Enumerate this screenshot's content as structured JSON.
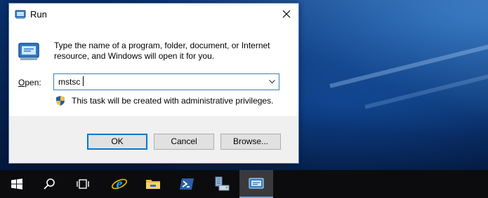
{
  "window": {
    "title": "Run",
    "icon": "run-app-icon",
    "close_icon": "close-icon"
  },
  "body": {
    "description": "Type the name of a program, folder, document, or Internet resource, and Windows will open it for you.",
    "open_label_prefix": "",
    "open_label_accel": "O",
    "open_label_suffix": "pen:",
    "open_value": "mstsc",
    "admin_note": "This task will be created with administrative privileges."
  },
  "buttons": {
    "ok": "OK",
    "cancel": "Cancel",
    "browse": "Browse..."
  },
  "taskbar": {
    "items": [
      {
        "icon": "windows-start-icon"
      },
      {
        "icon": "search-icon"
      },
      {
        "icon": "task-view-icon"
      },
      {
        "icon": "internet-explorer-icon"
      },
      {
        "icon": "file-explorer-icon"
      },
      {
        "icon": "powershell-icon"
      },
      {
        "icon": "server-manager-icon"
      },
      {
        "icon": "run-app-icon",
        "active": true
      }
    ]
  },
  "colors": {
    "accent": "#0078d7",
    "taskbar": "#0c0c0e",
    "desktop": "#0a2f6e"
  }
}
